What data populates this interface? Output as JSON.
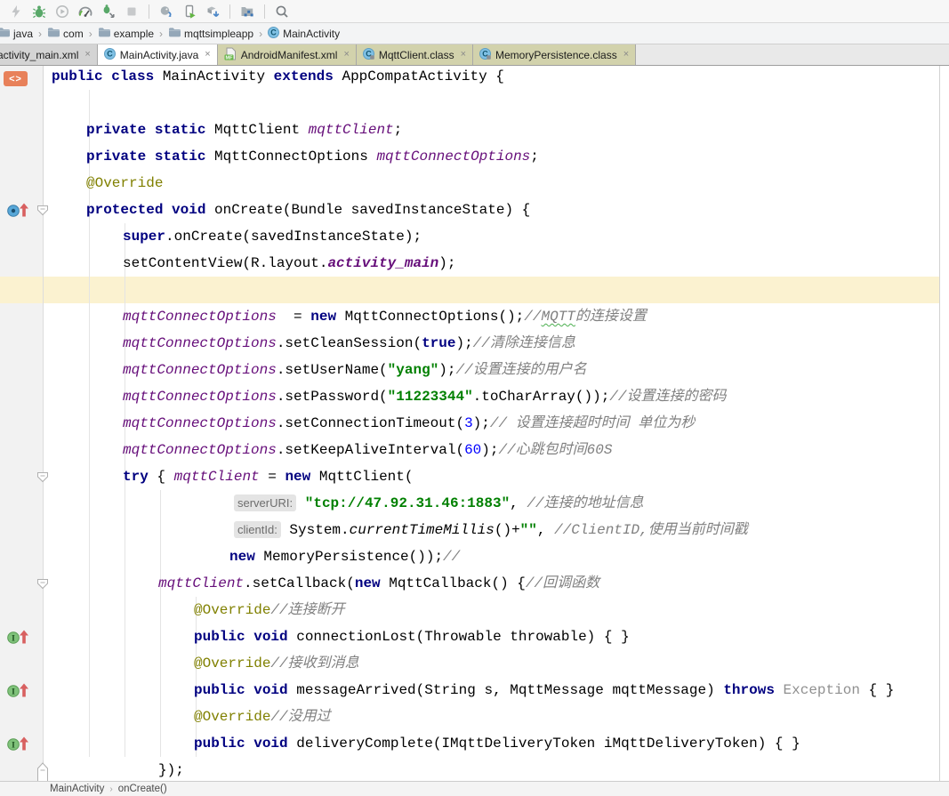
{
  "app": "Android Studio code editor",
  "toolbar": {
    "groups": [
      [
        {
          "name": "run-lightning",
          "disabled": true
        },
        {
          "name": "debug-bug",
          "disabled": false
        },
        {
          "name": "run-profile-circle",
          "disabled": true
        },
        {
          "name": "profiler-gauge",
          "disabled": false
        },
        {
          "name": "attach-debugger-bug",
          "disabled": false
        },
        {
          "name": "stop-square",
          "disabled": true
        }
      ],
      [
        {
          "name": "gradle-sync",
          "disabled": false
        },
        {
          "name": "run-on-device",
          "disabled": false
        },
        {
          "name": "sdk-manager-download",
          "disabled": false
        }
      ],
      [
        {
          "name": "project-structure",
          "disabled": false
        }
      ],
      [
        {
          "name": "search-everywhere",
          "disabled": false
        }
      ]
    ]
  },
  "breadcrumb": {
    "items": [
      {
        "label": "java",
        "icon": "folder"
      },
      {
        "label": "com",
        "icon": "folder"
      },
      {
        "label": "example",
        "icon": "folder"
      },
      {
        "label": "mqttsimpleapp",
        "icon": "folder"
      },
      {
        "label": "MainActivity",
        "icon": "class-c"
      }
    ],
    "separator": "›"
  },
  "tabs": {
    "items": [
      {
        "label": "activity_main.xml",
        "icon": null,
        "style": "gray",
        "close": "×"
      },
      {
        "label": "MainActivity.java",
        "icon": "class-c",
        "style": "active",
        "close": "×"
      },
      {
        "label": "AndroidManifest.xml",
        "icon": "manifest",
        "style": "khaki",
        "close": "×"
      },
      {
        "label": "MqttClient.class",
        "icon": "class-c-locked",
        "style": "khaki",
        "close": "×"
      },
      {
        "label": "MemoryPersistence.class",
        "icon": "class-c-locked",
        "style": "khaki",
        "close": "×"
      }
    ]
  },
  "editor": {
    "caret_line_index": 8,
    "colors": {
      "keyword": "#000080",
      "field": "#660e7a",
      "string": "#008000",
      "number": "#0000ff",
      "comment": "#808080",
      "annotation": "#808000",
      "caret_line_bg": "#fbf2d0",
      "hint_bg": "#e4e4e4",
      "gutter_bg": "#f2f2f2"
    },
    "lines": [
      {
        "ind": 0,
        "segs": [
          [
            "kw",
            "public class"
          ],
          [
            "pl",
            " MainActivity "
          ],
          [
            "kw",
            "extends"
          ],
          [
            "pl",
            " AppCompatActivity {"
          ]
        ]
      },
      {
        "ind": 0,
        "segs": []
      },
      {
        "ind": 39,
        "segs": [
          [
            "kw",
            "private static"
          ],
          [
            "pl",
            " MqttClient "
          ],
          [
            "fld",
            "mqttClient"
          ],
          [
            "pl",
            ";"
          ]
        ]
      },
      {
        "ind": 39,
        "segs": [
          [
            "kw",
            "private static"
          ],
          [
            "pl",
            " MqttConnectOptions "
          ],
          [
            "fld",
            "mqttConnectOptions"
          ],
          [
            "pl",
            ";"
          ]
        ]
      },
      {
        "ind": 39,
        "segs": [
          [
            "ann",
            "@Override"
          ]
        ]
      },
      {
        "ind": 39,
        "gutter": "override",
        "fold": "open",
        "segs": [
          [
            "kw",
            "protected void"
          ],
          [
            "pl",
            " onCreate(Bundle savedInstanceState) {"
          ]
        ]
      },
      {
        "ind": 80,
        "segs": [
          [
            "kw",
            "super"
          ],
          [
            "pl",
            ".onCreate(savedInstanceState);"
          ]
        ]
      },
      {
        "ind": 80,
        "segs": [
          [
            "pl",
            "setContentView(R.layout."
          ],
          [
            "fldb",
            "activity_main"
          ],
          [
            "pl",
            ");"
          ]
        ]
      },
      {
        "ind": 80,
        "caret": true,
        "segs": []
      },
      {
        "ind": 80,
        "segs": [
          [
            "fld",
            "mqttConnectOptions"
          ],
          [
            "pl",
            "  = "
          ],
          [
            "kw",
            "new"
          ],
          [
            "pl",
            " MqttConnectOptions();"
          ],
          [
            "cmt",
            "//"
          ],
          [
            "cmtsq",
            "MQTT"
          ],
          [
            "cmt",
            "的连接设置"
          ]
        ]
      },
      {
        "ind": 80,
        "segs": [
          [
            "fld",
            "mqttConnectOptions"
          ],
          [
            "pl",
            ".setCleanSession("
          ],
          [
            "kw",
            "true"
          ],
          [
            "pl",
            ");"
          ],
          [
            "cmt",
            "//清除连接信息"
          ]
        ]
      },
      {
        "ind": 80,
        "segs": [
          [
            "fld",
            "mqttConnectOptions"
          ],
          [
            "pl",
            ".setUserName("
          ],
          [
            "str",
            "\"yang\""
          ],
          [
            "pl",
            ");"
          ],
          [
            "cmt",
            "//设置连接的用户名"
          ]
        ]
      },
      {
        "ind": 80,
        "segs": [
          [
            "fld",
            "mqttConnectOptions"
          ],
          [
            "pl",
            ".setPassword("
          ],
          [
            "str",
            "\"11223344\""
          ],
          [
            "pl",
            ".toCharArray());"
          ],
          [
            "cmt",
            "//设置连接的密码"
          ]
        ]
      },
      {
        "ind": 80,
        "segs": [
          [
            "fld",
            "mqttConnectOptions"
          ],
          [
            "pl",
            ".setConnectionTimeout("
          ],
          [
            "num",
            "3"
          ],
          [
            "pl",
            ");"
          ],
          [
            "cmt",
            "// 设置连接超时时间 单位为秒"
          ]
        ]
      },
      {
        "ind": 80,
        "segs": [
          [
            "fld",
            "mqttConnectOptions"
          ],
          [
            "pl",
            ".setKeepAliveInterval("
          ],
          [
            "num",
            "60"
          ],
          [
            "pl",
            ");"
          ],
          [
            "cmt",
            "//心跳包时间60S"
          ]
        ]
      },
      {
        "ind": 80,
        "fold": "open",
        "segs": [
          [
            "kw",
            "try"
          ],
          [
            "pl",
            " { "
          ],
          [
            "fld",
            "mqttClient"
          ],
          [
            "pl",
            " = "
          ],
          [
            "kw",
            "new"
          ],
          [
            "pl",
            " MqttClient("
          ]
        ]
      },
      {
        "ind": 205,
        "segs": [
          [
            "hint",
            "serverURI:"
          ],
          [
            "pl",
            " "
          ],
          [
            "str",
            "\"tcp://47.92.31.46:1883\""
          ],
          [
            "pl",
            ", "
          ],
          [
            "cmt",
            "//连接的地址信息"
          ]
        ]
      },
      {
        "ind": 205,
        "segs": [
          [
            "hint",
            "clientId:"
          ],
          [
            "pl",
            " System."
          ],
          [
            "itl",
            "currentTimeMillis"
          ],
          [
            "pl",
            "()+"
          ],
          [
            "str",
            "\"\""
          ],
          [
            "pl",
            ", "
          ],
          [
            "cmt",
            "//ClientID,使用当前时间戳"
          ]
        ]
      },
      {
        "ind": 200,
        "segs": [
          [
            "kw",
            "new"
          ],
          [
            "pl",
            " MemoryPersistence());"
          ],
          [
            "cmt",
            "//"
          ]
        ]
      },
      {
        "ind": 120,
        "fold": "open",
        "segs": [
          [
            "fld",
            "mqttClient"
          ],
          [
            "pl",
            ".setCallback("
          ],
          [
            "kw",
            "new"
          ],
          [
            "pl",
            " MqttCallback() {"
          ],
          [
            "cmt",
            "//回调函数"
          ]
        ]
      },
      {
        "ind": 160,
        "segs": [
          [
            "ann",
            "@Override"
          ],
          [
            "cmt",
            "//连接断开"
          ]
        ]
      },
      {
        "ind": 160,
        "gutter": "implement",
        "segs": [
          [
            "kw",
            "public void"
          ],
          [
            "pl",
            " connectionLost(Throwable throwable) { }"
          ]
        ]
      },
      {
        "ind": 160,
        "segs": [
          [
            "ann",
            "@Override"
          ],
          [
            "cmt",
            "//接收到消息"
          ]
        ]
      },
      {
        "ind": 160,
        "gutter": "implement",
        "segs": [
          [
            "kw",
            "public void"
          ],
          [
            "pl",
            " messageArrived(String s, MqttMessage mqttMessage) "
          ],
          [
            "kw",
            "throws"
          ],
          [
            "gry",
            " Exception "
          ],
          [
            "pl",
            "{ }"
          ]
        ]
      },
      {
        "ind": 160,
        "segs": [
          [
            "ann",
            "@Override"
          ],
          [
            "cmt",
            "//没用过"
          ]
        ]
      },
      {
        "ind": 160,
        "gutter": "implement",
        "segs": [
          [
            "kw",
            "public void"
          ],
          [
            "pl",
            " deliveryComplete(IMqttDeliveryToken iMqttDeliveryToken) { }"
          ]
        ]
      },
      {
        "ind": 120,
        "fold": "end",
        "segs": [
          [
            "pl",
            "});"
          ]
        ]
      }
    ]
  },
  "status_bar": {
    "items": [
      "MainActivity",
      "onCreate()"
    ],
    "separator": "›"
  }
}
